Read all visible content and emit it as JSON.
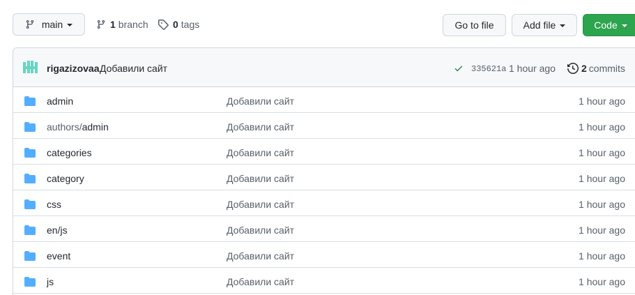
{
  "toolbar": {
    "branch_label": "main",
    "branches_count": "1",
    "branches_label": "branch",
    "tags_count": "0",
    "tags_label": "tags",
    "goto_file_label": "Go to file",
    "add_file_label": "Add file",
    "code_label": "Code"
  },
  "commit": {
    "author": "rigazizovaa",
    "message": "Добавили сайт",
    "sha": "335621a",
    "time": "1 hour ago",
    "commits_count": "2",
    "commits_label": "commits"
  },
  "files": [
    {
      "prefix": "",
      "name": "admin",
      "message": "Добавили сайт",
      "age": "1 hour ago"
    },
    {
      "prefix": "authors/",
      "name": "admin",
      "message": "Добавили сайт",
      "age": "1 hour ago"
    },
    {
      "prefix": "",
      "name": "categories",
      "message": "Добавили сайт",
      "age": "1 hour ago"
    },
    {
      "prefix": "",
      "name": "category",
      "message": "Добавили сайт",
      "age": "1 hour ago"
    },
    {
      "prefix": "",
      "name": "css",
      "message": "Добавили сайт",
      "age": "1 hour ago"
    },
    {
      "prefix": "",
      "name": "en/js",
      "message": "Добавили сайт",
      "age": "1 hour ago"
    },
    {
      "prefix": "",
      "name": "event",
      "message": "Добавили сайт",
      "age": "1 hour ago"
    },
    {
      "prefix": "",
      "name": "js",
      "message": "Добавили сайт",
      "age": "1 hour ago"
    }
  ],
  "colors": {
    "folder": "#54aeff",
    "code_button": "#2da44e",
    "check": "#1a7f37"
  }
}
